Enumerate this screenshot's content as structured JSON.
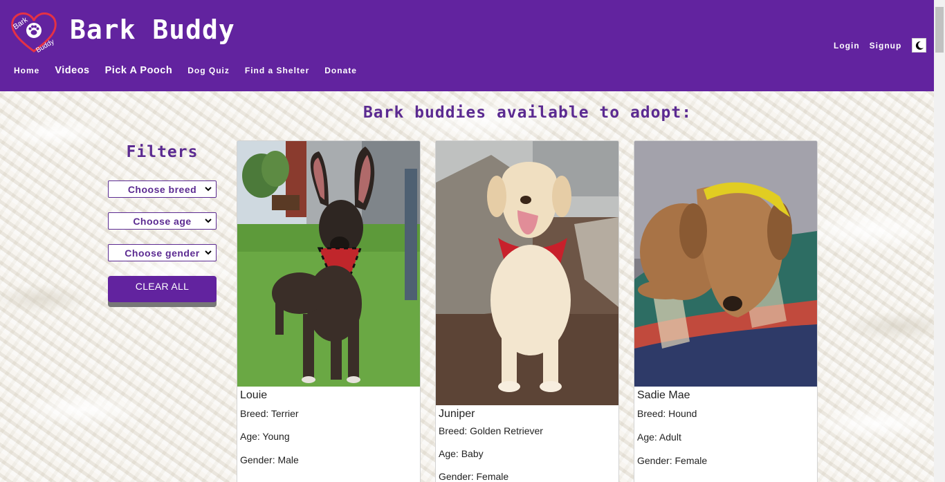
{
  "header": {
    "logo_text_top": "Bark",
    "logo_text_bottom": "Buddy",
    "title": "Bark Buddy",
    "nav": [
      {
        "label": "Home"
      },
      {
        "label": "Videos"
      },
      {
        "label": "Pick A Pooch"
      },
      {
        "label": "Dog Quiz"
      },
      {
        "label": "Find a Shelter"
      },
      {
        "label": "Donate"
      }
    ],
    "login_label": "Login",
    "signup_label": "Signup",
    "theme_icon": "moon-icon"
  },
  "main": {
    "heading": "Bark buddies available to adopt:"
  },
  "filters": {
    "title": "Filters",
    "breed_select": "Choose breed",
    "age_select": "Choose age",
    "gender_select": "Choose gender",
    "clear_label": "CLEAR ALL"
  },
  "dogs": [
    {
      "name": "Louie",
      "breed": "Breed: Terrier",
      "age": "Age: Young",
      "gender": "Gender: Male"
    },
    {
      "name": "Juniper",
      "breed": "Breed: Golden Retriever",
      "age": "Age: Baby",
      "gender": "Gender: Female"
    },
    {
      "name": "Sadie Mae",
      "breed": "Breed: Hound",
      "age": "Age: Adult",
      "gender": "Gender: Female"
    }
  ],
  "colors": {
    "brand_purple": "#62239f",
    "heading_purple": "#5b2a91",
    "logo_red": "#e53145"
  }
}
